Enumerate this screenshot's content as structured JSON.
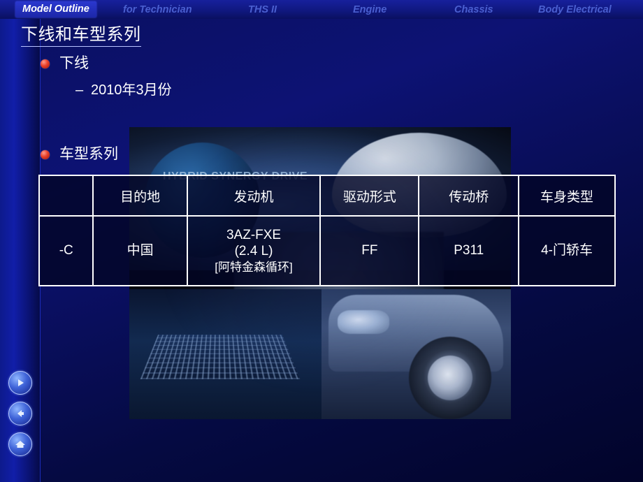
{
  "topnav": {
    "items": [
      {
        "label": "Model Outline",
        "active": true
      },
      {
        "label": "for Technician",
        "active": false
      },
      {
        "label": "THS II",
        "active": false
      },
      {
        "label": "Engine",
        "active": false
      },
      {
        "label": "Chassis",
        "active": false
      },
      {
        "label": "Body Electrical",
        "active": false
      }
    ]
  },
  "slide": {
    "title": "下线和车型系列",
    "bullets": [
      {
        "label": "下线",
        "sub": "2010年3月份"
      },
      {
        "label": "车型系列"
      }
    ],
    "sub_dash": "–"
  },
  "table": {
    "headers": [
      "",
      "目的地",
      "发动机",
      "驱动形式",
      "传动桥",
      "车身类型"
    ],
    "rows": [
      {
        "code": "-C",
        "destination": "中国",
        "engine_line1": "3AZ-FXE",
        "engine_line2": "(2.4 L)",
        "engine_line3": "[阿特金森循环]",
        "drive": "FF",
        "transaxle": "P311",
        "body": "4-门轿车"
      }
    ]
  },
  "photo": {
    "overlay_text": "HYBRID SYNERGY DRIVE"
  },
  "controls": {
    "next": "next-slide",
    "prev": "previous-slide",
    "home": "home"
  },
  "colors": {
    "accent": "#2b38cf",
    "inactive_nav": "#4a5fd0",
    "bullet": "#e8402a",
    "text": "#ffffff"
  }
}
